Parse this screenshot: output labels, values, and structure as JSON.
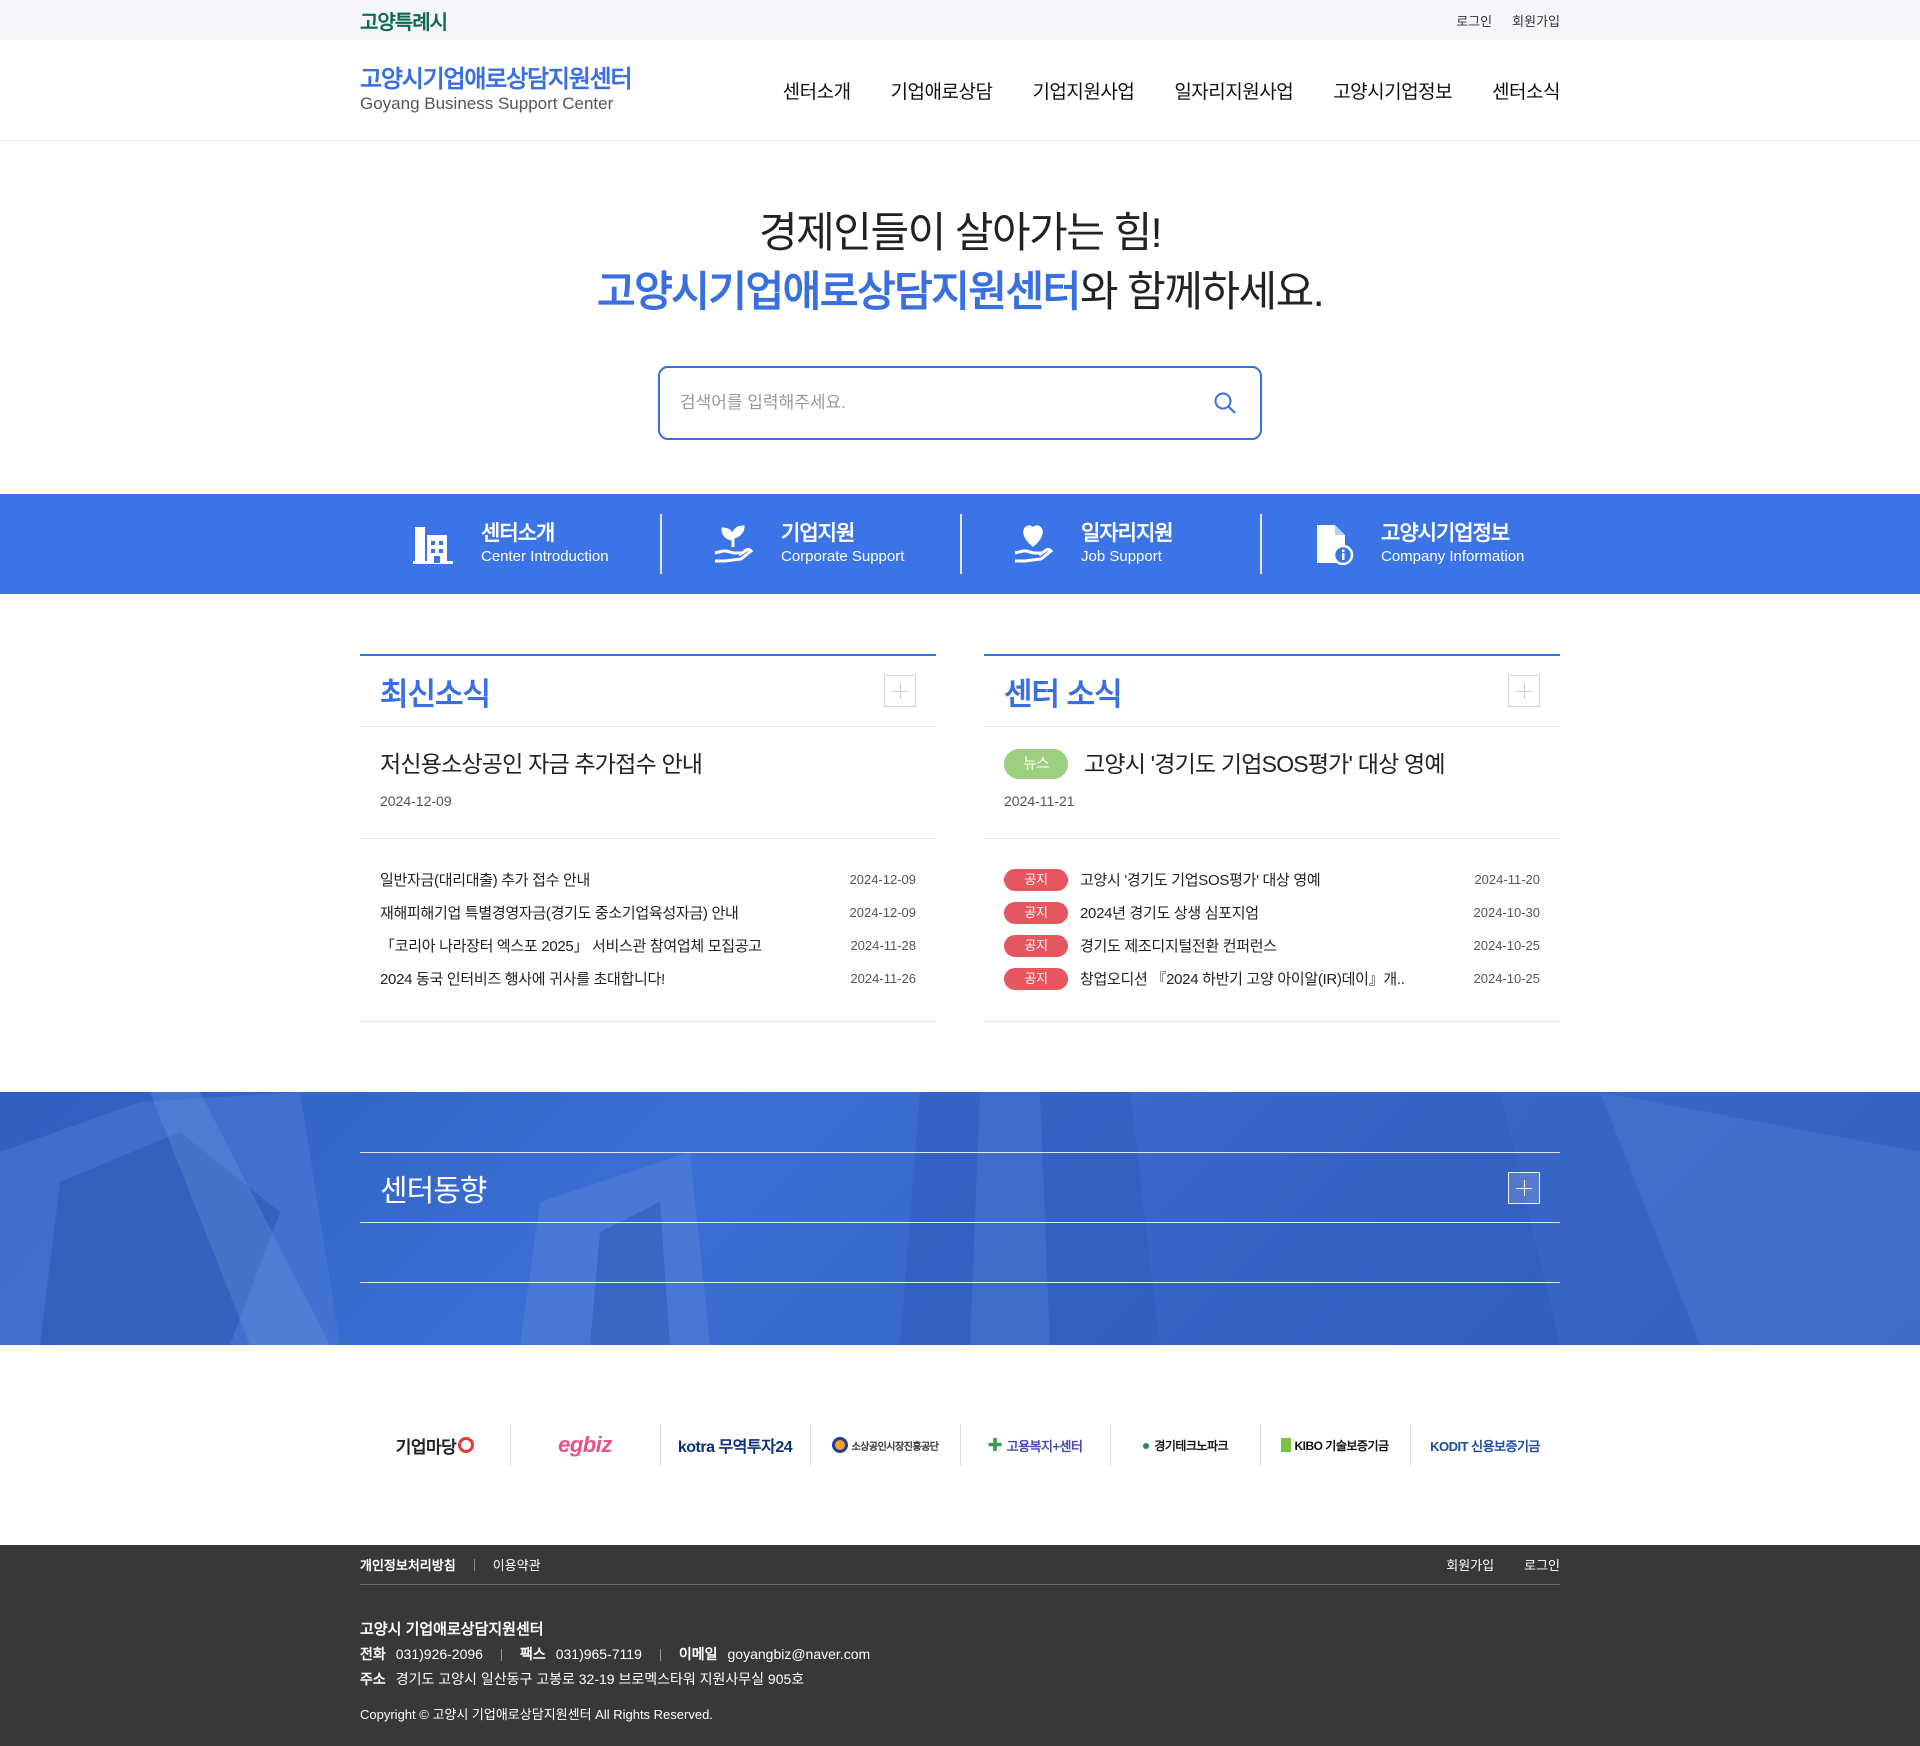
{
  "topbar": {
    "city_logo": "고양특례시",
    "login": "로그인",
    "signup": "회원가입"
  },
  "header": {
    "brand_ko": "고양시기업애로상담지원센터",
    "brand_en": "Goyang Business Support Center",
    "nav": [
      "센터소개",
      "기업애로상담",
      "기업지원사업",
      "일자리지원사업",
      "고양시기업정보",
      "센터소식"
    ]
  },
  "hero": {
    "line1": "경제인들이 살아가는 힘!",
    "line2_highlight": "고양시기업애로상담지원센터",
    "line2_rest": "와 함께하세요.",
    "search_placeholder": "검색어를 입력해주세요."
  },
  "quick_menu": [
    {
      "title": "센터소개",
      "sub": "Center Introduction",
      "icon": "building-icon"
    },
    {
      "title": "기업지원",
      "sub": "Corporate Support",
      "icon": "plant-hand-icon"
    },
    {
      "title": "일자리지원",
      "sub": "Job Support",
      "icon": "heart-hand-icon"
    },
    {
      "title": "고양시기업정보",
      "sub": "Company Information",
      "icon": "document-info-icon"
    }
  ],
  "latest": {
    "title": "최신소식",
    "featured": {
      "title": "저신용소상공인 자금 추가접수 안내",
      "date": "2024-12-09"
    },
    "items": [
      {
        "title": "일반자금(대리대출) 추가 접수 안내",
        "date": "2024-12-09"
      },
      {
        "title": "재해피해기업 특별경영자금(경기도 중소기업육성자금) 안내",
        "date": "2024-12-09"
      },
      {
        "title": "「코리아 나라장터 엑스포 2025」 서비스관 참여업체 모집공고",
        "date": "2024-11-28"
      },
      {
        "title": "2024 동국 인터비즈 행사에 귀사를 초대합니다!",
        "date": "2024-11-26"
      }
    ]
  },
  "center_news": {
    "title": "센터 소식",
    "featured": {
      "badge": "뉴스",
      "title": "고양시 '경기도 기업SOS평가' 대상 영예",
      "date": "2024-11-21"
    },
    "items": [
      {
        "badge": "공지",
        "title": "고양시 '경기도 기업SOS평가' 대상 영예",
        "date": "2024-11-20"
      },
      {
        "badge": "공지",
        "title": "2024년 경기도 상생 심포지엄",
        "date": "2024-10-30"
      },
      {
        "badge": "공지",
        "title": "경기도 제조디지털전환 컨퍼런스",
        "date": "2024-10-25"
      },
      {
        "badge": "공지",
        "title": "창업오디션 『2024 하반기 고양 아이알(IR)데이』개..",
        "date": "2024-10-25"
      }
    ]
  },
  "trend": {
    "title": "센터동향"
  },
  "partners": [
    "기업마당",
    "egbiz",
    "kotra 무역투자24",
    "소상공인시장진흥공단",
    "고용복지+센터",
    "경기테크노파크",
    "KIBO 기술보증기금",
    "KODIT 신용보증기금"
  ],
  "footer": {
    "privacy": "개인정보처리방침",
    "terms": "이용약관",
    "signup": "회원가입",
    "login": "로그인",
    "org": "고양시 기업애로상담지원센터",
    "tel_label": "전화",
    "tel": "031)926-2096",
    "fax_label": "팩스",
    "fax": "031)965-7119",
    "email_label": "이메일",
    "email": "goyangbiz@naver.com",
    "addr_label": "주소",
    "addr": "경기도 고양시 일산동구 고봉로 32-19 브로멕스타워 지원사무실 905호",
    "copyright": "Copyright © 고양시 기업애로상담지원센터 All Rights Reserved."
  },
  "colors": {
    "brand": "#3a6fe0",
    "quick_bg": "#3a74e6",
    "news_badge": "#9ccf7e",
    "notice_badge": "#e5565f",
    "footer_bg": "#383838",
    "city_logo": "#0f6b4f"
  }
}
